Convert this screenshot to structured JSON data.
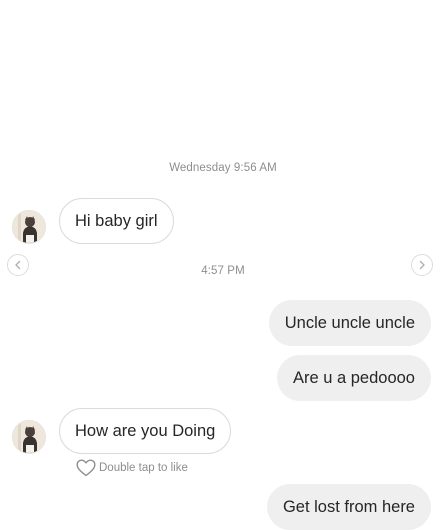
{
  "thread": {
    "timestamp_1": "Wednesday 9:56 AM",
    "timestamp_2": "4:57 PM"
  },
  "messages": [
    {
      "from": "them",
      "text": "Hi baby girl"
    },
    {
      "from": "me",
      "text": "Uncle uncle uncle"
    },
    {
      "from": "me",
      "text": "Are u a pedoooo"
    },
    {
      "from": "them",
      "text": "How are you Doing"
    },
    {
      "from": "me",
      "text": "Get lost from here"
    }
  ],
  "like_hint": {
    "label": "Double tap to like",
    "icon": "heart-outline-icon"
  },
  "nav": {
    "prev_icon": "chevron-left-icon",
    "next_icon": "chevron-right-icon"
  },
  "colors": {
    "outgoing_bubble": "#efefef",
    "incoming_border": "#dbdbdb",
    "muted_text": "#8e8e8e",
    "text": "#262626"
  }
}
